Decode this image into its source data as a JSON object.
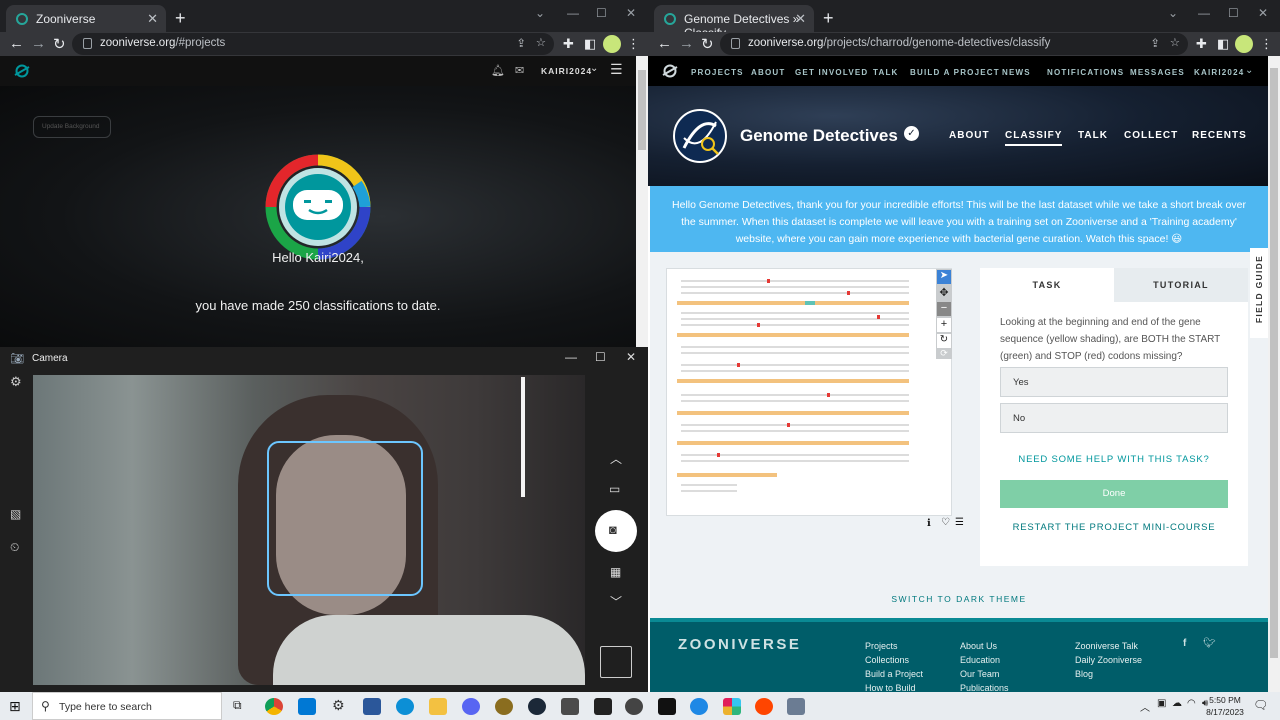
{
  "left_browser": {
    "tab_title": "Zooniverse",
    "url_host": "zooniverse.org",
    "url_path": "/#projects",
    "user_menu": "KAIRI2024",
    "update_bg_label": "Update Background",
    "greeting_line1": "Hello Kairi2024,",
    "greeting_line2": "you have made 250 classifications to date."
  },
  "camera": {
    "title": "Camera"
  },
  "right_browser": {
    "tab_title": "Genome Detectives » Classify —",
    "url_host": "zooniverse.org",
    "url_path": "/projects/charrod/genome-detectives/classify",
    "nav": {
      "projects": "PROJECTS",
      "about": "ABOUT",
      "get_involved": "GET INVOLVED",
      "talk": "TALK",
      "build": "BUILD A PROJECT",
      "news": "NEWS",
      "notifications": "NOTIFICATIONS",
      "messages": "MESSAGES",
      "user": "KAIRI2024"
    },
    "project": {
      "name": "Genome Detectives",
      "links": {
        "about": "ABOUT",
        "classify": "CLASSIFY",
        "talk": "TALK",
        "collect": "COLLECT",
        "recents": "RECENTS"
      }
    },
    "banner_text": "Hello Genome Detectives, thank you for your incredible efforts! This will be the last dataset while we take a short break over the summer. When this dataset is complete we will leave you with a training set on Zooniverse and a 'Training academy' website, where you can gain more experience with bacterial gene curation. Watch this space! 😃",
    "task": {
      "tab_task": "TASK",
      "tab_tutorial": "TUTORIAL",
      "question": "Looking at the beginning and end of the gene sequence (yellow shading), are BOTH the START (green) and STOP (red) codons missing?",
      "answers": [
        "Yes",
        "No"
      ],
      "help": "NEED SOME HELP WITH THIS TASK?",
      "done": "Done",
      "restart": "RESTART THE PROJECT MINI-COURSE"
    },
    "field_guide": "FIELD GUIDE",
    "dark_theme": "SWITCH TO DARK THEME",
    "footer": {
      "logo": "ZOONIVERSE",
      "col1": [
        "Projects",
        "Collections",
        "Build a Project",
        "How to Build"
      ],
      "col2": [
        "About Us",
        "Education",
        "Our Team",
        "Publications"
      ],
      "col3": [
        "Zooniverse Talk",
        "Daily Zooniverse",
        "Blog"
      ]
    }
  },
  "taskbar": {
    "search_placeholder": "Type here to search",
    "time": "5:50 PM",
    "date": "8/17/2023"
  },
  "colors": {
    "banner": "#4eb7f1",
    "done_button": "#7fcfa7",
    "teal": "#00979d",
    "footer": "#005d69"
  }
}
